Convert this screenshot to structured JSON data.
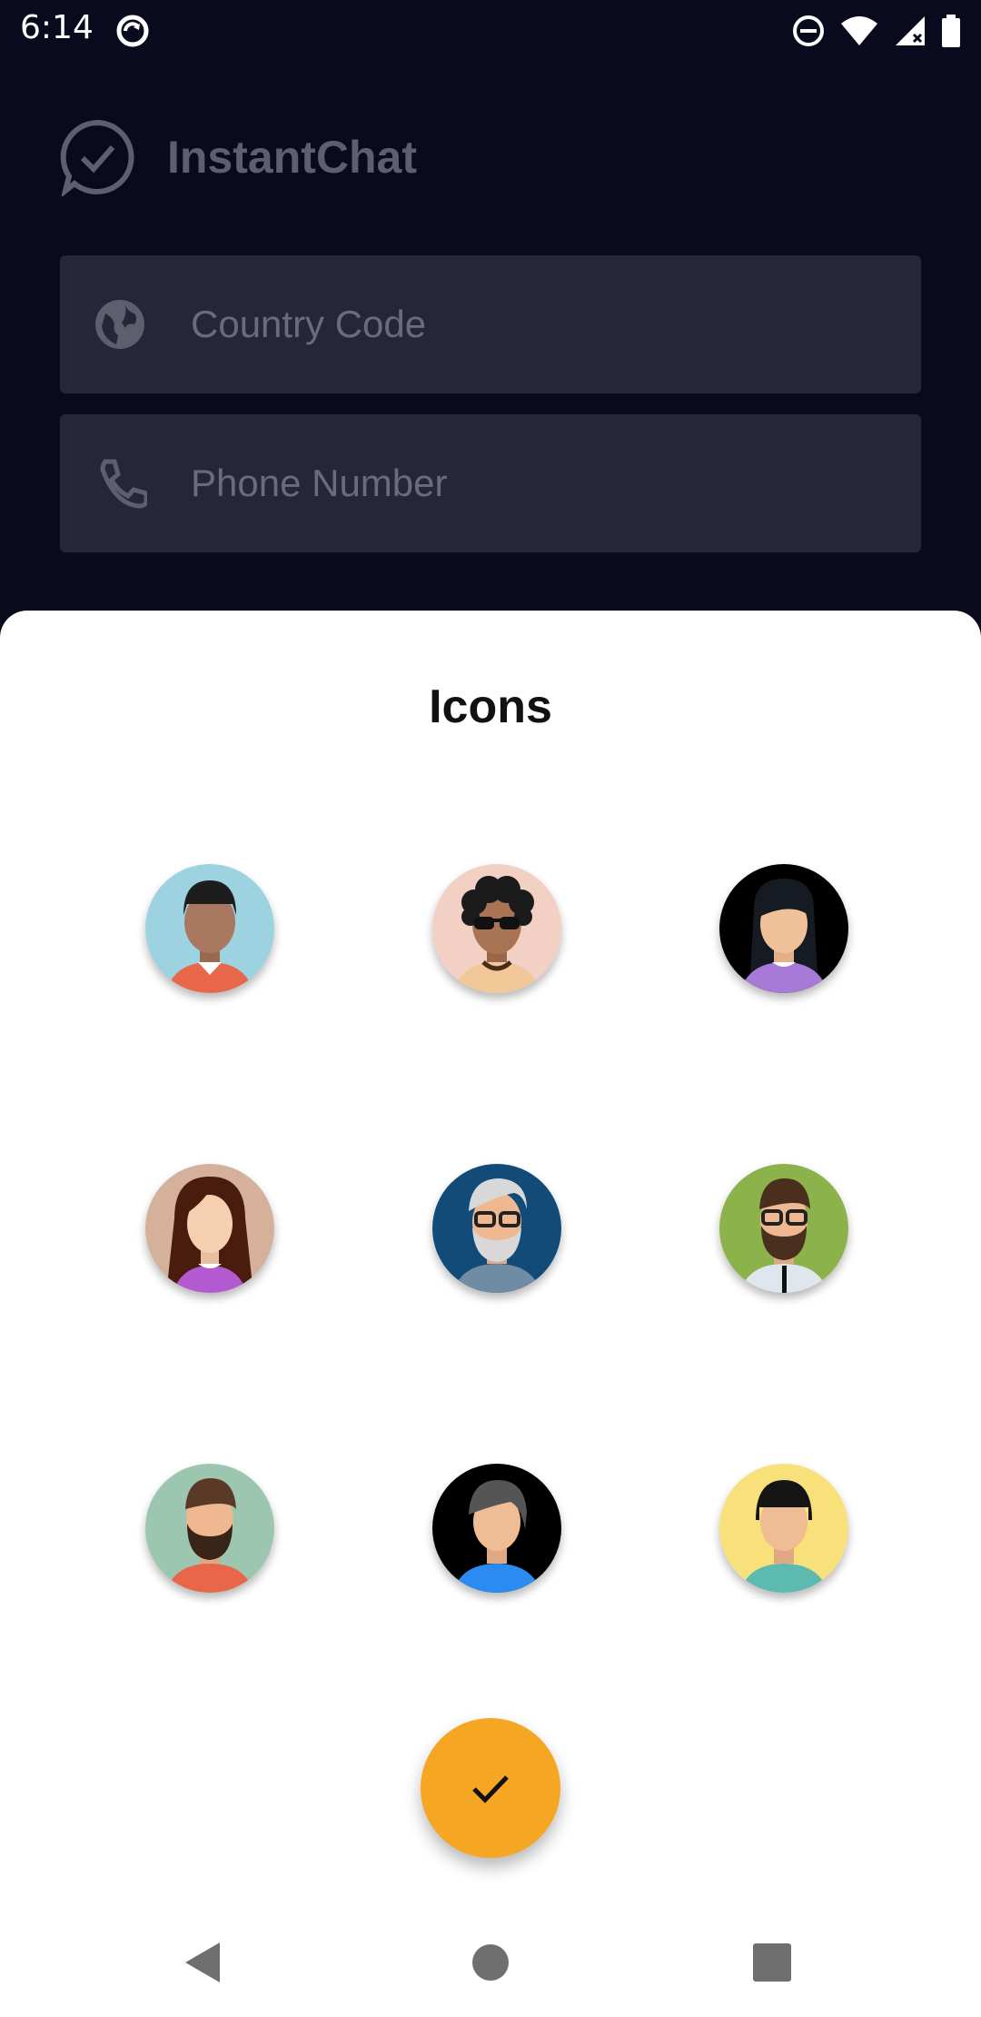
{
  "status_bar": {
    "time": "6:14",
    "icons": [
      "sync-icon",
      "do-not-disturb-icon",
      "wifi-icon",
      "signal-icon",
      "battery-icon"
    ]
  },
  "background_app": {
    "title": "InstantChat",
    "country_code_placeholder": "Country Code",
    "phone_number_placeholder": "Phone Number"
  },
  "sheet": {
    "title": "Icons",
    "avatars": [
      "avatar-man-short-hair",
      "avatar-man-curly-sunglasses",
      "avatar-woman-black-hair",
      "avatar-woman-long-hair",
      "avatar-old-man-glasses",
      "avatar-bearded-man-glasses",
      "avatar-bearded-man",
      "avatar-person-gray-hair",
      "avatar-woman-bangs"
    ],
    "confirm_icon": "check-icon"
  },
  "colors": {
    "background": "#0a0a1f",
    "field": "#26263a",
    "accent": "#f5a623"
  },
  "nav_bar": [
    "back-icon",
    "home-icon",
    "recents-icon"
  ]
}
